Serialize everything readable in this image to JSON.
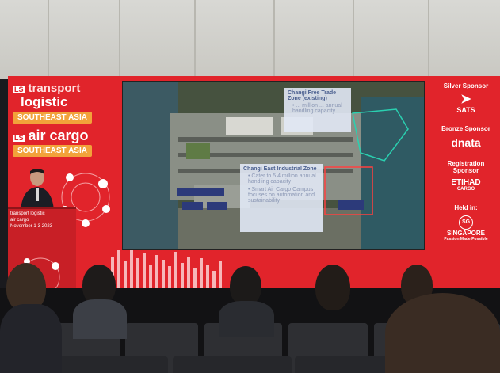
{
  "event": {
    "brand_line1": "transport",
    "brand_line2": "logistic",
    "region1": "SOUTHEAST ASIA",
    "brand_air": "air cargo",
    "region2": "SOUTHEAST ASIA",
    "tag": "LS"
  },
  "slide": {
    "callout_ftz": {
      "title": "Changi Free Trade Zone (existing)",
      "bullets": [
        "• ... million ... annual handling capacity"
      ]
    },
    "callout_east": {
      "title": "Changi East Industrial Zone",
      "bullets": [
        "• Cater to 5.4 million annual handling capacity",
        "• Smart Air Cargo Campus focuses on automation and sustainability"
      ]
    }
  },
  "sponsors": {
    "silver_heading": "Silver Sponsor",
    "silver_logo": "SATS",
    "bronze_heading": "Bronze Sponsor",
    "bronze_logo": "dnata",
    "registration_heading": "Registration Sponsor",
    "registration_logo": "ETIHAD",
    "registration_sub": "CARGO",
    "held_in_heading": "Held in:",
    "held_in_logo": "SINGAPORE",
    "held_in_sub": "Passion Made Possible"
  },
  "podium": {
    "brand": "transport logistic",
    "sub": "air cargo",
    "date": "November 1-3 2023"
  }
}
